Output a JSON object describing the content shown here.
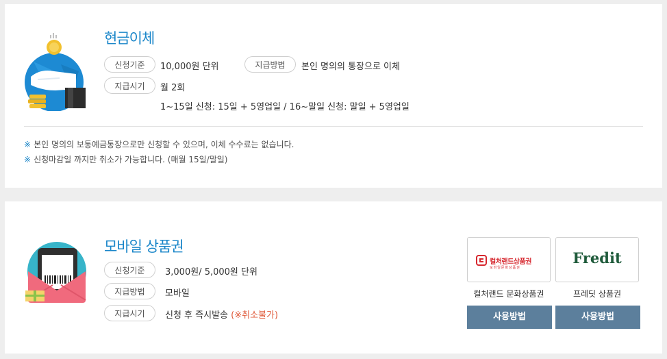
{
  "cash": {
    "title": "현금이체",
    "criteria_tag": "신청기준",
    "criteria_value": "10,000원 단위",
    "method_tag": "지급방법",
    "method_value": "본인 명의의 통장으로 이체",
    "timing_tag": "지급시기",
    "timing_value": "월 2회",
    "timing_detail": "1~15일 신청: 15일 + 5영업일 / 16~말일 신청: 말일 + 5영업일",
    "notes": [
      {
        "mark": "※",
        "text": "본인 명의의 보통예금통장으로만 신청할 수 있으며, 이체 수수료는 없습니다."
      },
      {
        "mark": "※",
        "text": "신청마감일 까지만 취소가 가능합니다. (매월 15일/말일)"
      }
    ]
  },
  "mobile": {
    "title": "모바일 상품권",
    "criteria_tag": "신청기준",
    "criteria_value": "3,000원/ 5,000원 단위",
    "method_tag": "지급방법",
    "method_value": "모바일",
    "timing_tag": "지급시기",
    "timing_value": "신청 후 즉시발송",
    "timing_warning": "(※취소불가)",
    "vouchers": [
      {
        "logo_text": "컬처랜드상품권",
        "logo_sub": "모바일문화상품권",
        "caption": "컬처랜드 문화상품권",
        "button": "사용방법"
      },
      {
        "logo_text": "Fredit",
        "caption": "프레딧 상품권",
        "button": "사용방법"
      }
    ]
  },
  "colors": {
    "accent": "#1a86c9",
    "button": "#5c7f9c",
    "warning": "#e05a3a",
    "culture_red": "#d6272e",
    "fredit_green": "#1e5a3a"
  },
  "icons": {
    "cash": "cash-transfer-icon",
    "mobile": "mobile-voucher-icon"
  }
}
